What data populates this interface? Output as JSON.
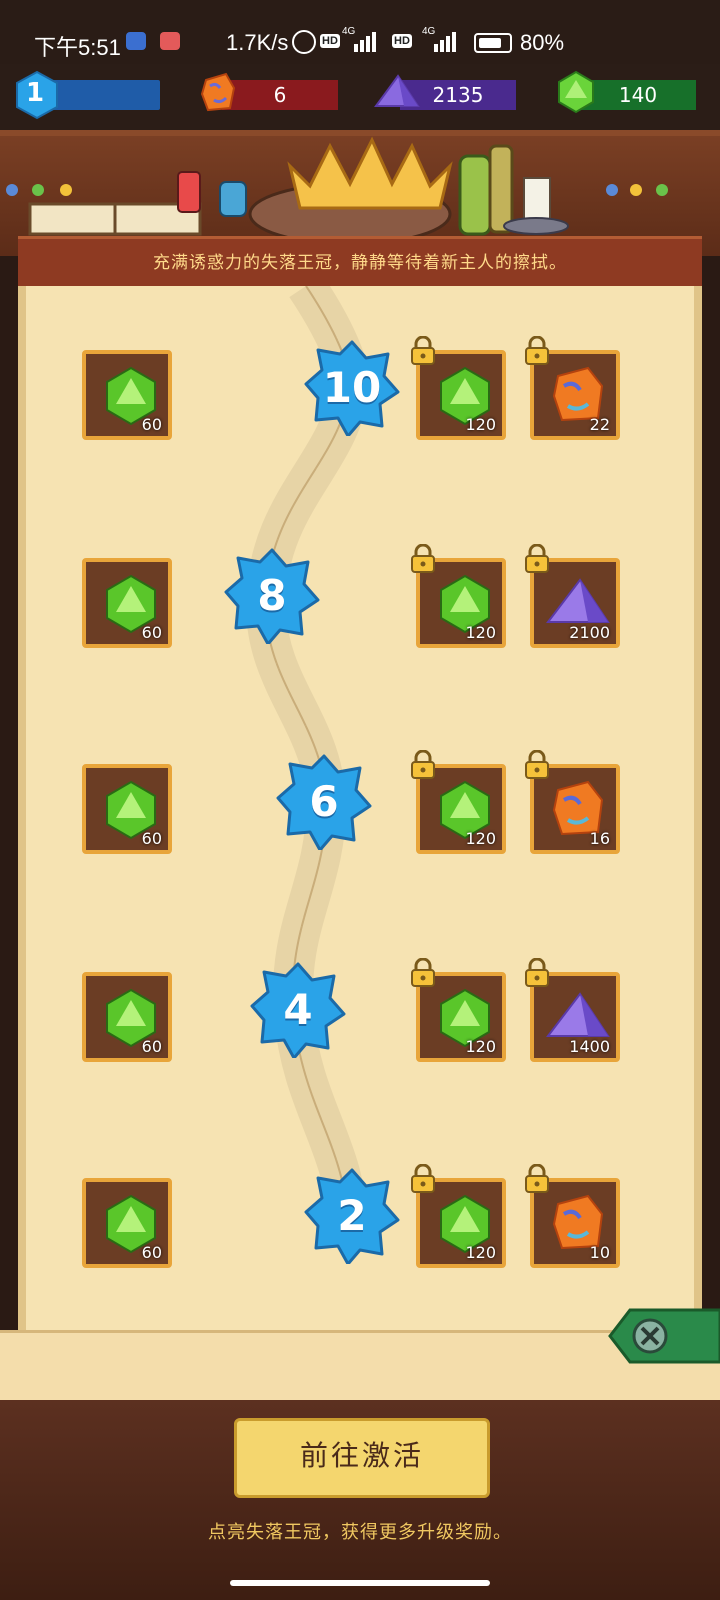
{
  "status": {
    "time": "下午5:51",
    "net_speed": "1.7K/s",
    "hd1": "HD",
    "hd2": "HD",
    "net1": "4G",
    "net2": "4G",
    "battery_text": "80%",
    "battery_level": 0.8
  },
  "resources": {
    "level": "1",
    "ore": "6",
    "crystal": "2135",
    "gem": "140"
  },
  "banner_text": "充满诱惑力的失落王冠，静静等待着新主人的擦拭。",
  "levels": [
    {
      "level": "10",
      "free_reward": {
        "icon": "green-gem",
        "value": "60"
      },
      "locked_rewards": [
        {
          "icon": "green-gem",
          "value": "120"
        },
        {
          "icon": "orange-ore",
          "value": "22"
        }
      ]
    },
    {
      "level": "8",
      "free_reward": {
        "icon": "green-gem",
        "value": "60"
      },
      "locked_rewards": [
        {
          "icon": "green-gem",
          "value": "120"
        },
        {
          "icon": "purple-crystal",
          "value": "2100"
        }
      ]
    },
    {
      "level": "6",
      "free_reward": {
        "icon": "green-gem",
        "value": "60"
      },
      "locked_rewards": [
        {
          "icon": "green-gem",
          "value": "120"
        },
        {
          "icon": "orange-ore",
          "value": "16"
        }
      ]
    },
    {
      "level": "4",
      "free_reward": {
        "icon": "green-gem",
        "value": "60"
      },
      "locked_rewards": [
        {
          "icon": "green-gem",
          "value": "120"
        },
        {
          "icon": "purple-crystal",
          "value": "1400"
        }
      ]
    },
    {
      "level": "2",
      "free_reward": {
        "icon": "green-gem",
        "value": "60"
      },
      "locked_rewards": [
        {
          "icon": "green-gem",
          "value": "120"
        },
        {
          "icon": "orange-ore",
          "value": "10"
        }
      ]
    }
  ],
  "footer": {
    "button_label": "前往激活",
    "hint": "点亮失落王冠，获得更多升级奖励。"
  },
  "colors": {
    "node_blue": "#2aa3e8",
    "tile_bg": "#6b3d24",
    "tile_border": "#e8a53a",
    "banner_text": "#ffd98a"
  }
}
